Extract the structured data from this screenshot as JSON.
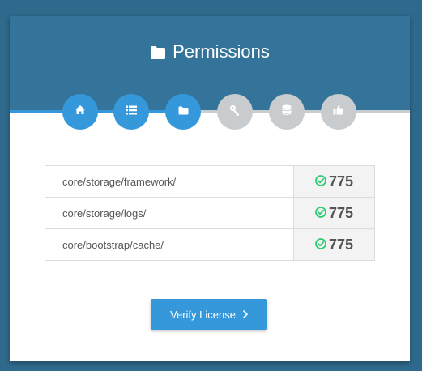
{
  "header": {
    "title": "Permissions",
    "title_icon": "folder-icon",
    "background_color": "#35749a"
  },
  "steps": [
    {
      "icon": "home-icon",
      "status": "complete"
    },
    {
      "icon": "list-icon",
      "status": "complete"
    },
    {
      "icon": "folder-icon",
      "status": "current"
    },
    {
      "icon": "key-icon",
      "status": "pending"
    },
    {
      "icon": "database-icon",
      "status": "pending"
    },
    {
      "icon": "thumbs-up-icon",
      "status": "pending"
    }
  ],
  "permissions": {
    "rows": [
      {
        "path": "core/storage/framework/",
        "value": "775",
        "status_icon": "check-circle-icon"
      },
      {
        "path": "core/storage/logs/",
        "value": "775",
        "status_icon": "check-circle-icon"
      },
      {
        "path": "core/bootstrap/cache/",
        "value": "775",
        "status_icon": "check-circle-icon"
      }
    ]
  },
  "actions": {
    "verify_label": "Verify License",
    "verify_icon": "chevron-right-icon"
  },
  "colors": {
    "accent": "#3498db",
    "page_background": "#2f6a8d",
    "success": "#2ecc71",
    "inactive_step": "#c8ccce"
  }
}
